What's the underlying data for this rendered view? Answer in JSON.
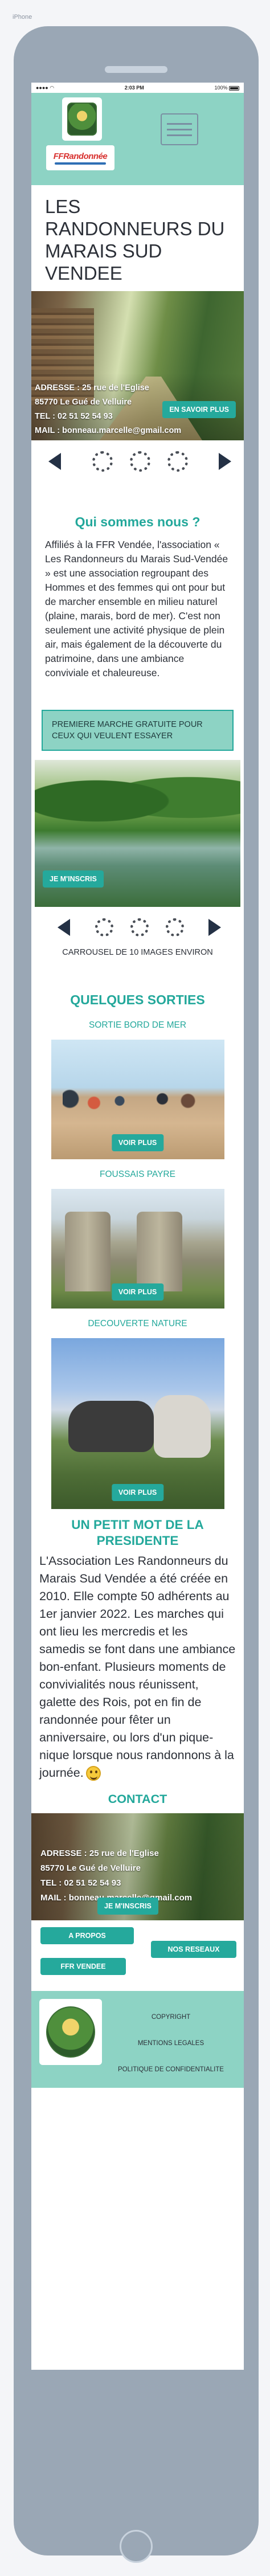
{
  "frame_label": "iPhone",
  "status_bar": {
    "time": "2:03 PM",
    "battery": "100%"
  },
  "header": {
    "ffr_logo_text": "FFRandonnée"
  },
  "site_title": "LES RANDONNEURS DU MARAIS SUD VENDEE",
  "hero": {
    "address": "ADRESSE : 25 rue de l'Eglise",
    "city": "85770 Le Gué de Velluire",
    "tel": "TEL : 02 51 52 54 93",
    "mail": "MAIL : bonneau.marcelle@gmail.com",
    "cta": "EN SAVOIR PLUS"
  },
  "about": {
    "title": "Qui sommes nous ?",
    "text": "Affiliés à la FFR Vendée, l'association « Les Randonneurs du Marais Sud-Vendée » est une association regroupant des Hommes et des femmes qui ont pour but de marcher ensemble en milieu naturel (plaine, marais, bord de mer). C'est non seulement une activité physique de plein air, mais également de la découverte du patrimoine, dans une ambiance conviviale et chaleureuse."
  },
  "promo": "PREMIERE MARCHE GRATUITE POUR CEUX QUI VEULENT ESSAYER",
  "inscription_label": "JE M'INSCRIS",
  "carousel_caption": "CARROUSEL DE 10 IMAGES ENVIRON",
  "sorties": {
    "title": "QUELQUES SORTIES",
    "items": [
      {
        "label": "SORTIE BORD DE MER",
        "cta": "VOIR PLUS"
      },
      {
        "label": "FOUSSAIS PAYRE",
        "cta": "VOIR PLUS"
      },
      {
        "label": "DECOUVERTE NATURE",
        "cta": "VOIR PLUS"
      }
    ]
  },
  "petit_mot": {
    "title": "UN PETIT MOT DE LA PRESIDENTE",
    "text": "L'Association Les Randonneurs du Marais Sud Vendée a été créée en 2010. Elle compte 50 adhérents au 1er janvier 2022. Les marches qui ont lieu les mercredis et les samedis se font dans une ambiance bon-enfant. Plusieurs moments de convivialités nous réunissent, galette des Rois, pot en fin de randonnée pour fêter un anniversaire, ou lors d'un pique-nique lorsque nous randonnons à la journée."
  },
  "contact": {
    "title": "CONTACT",
    "address": "ADRESSE : 25 rue de l'Eglise",
    "city": "85770 Le Gué de Velluire",
    "tel": "TEL : 02 51 52 54 93",
    "mail": "MAIL : bonneau.marcelle@gmail.com",
    "cta": "JE M'INSCRIS"
  },
  "footer": {
    "a_propos": "A PROPOS",
    "nos_reseaux": "NOS RESEAUX",
    "ffr_vendee": "FFR VENDEE",
    "copyright": "COPYRIGHT",
    "mentions": "MENTIONS LEGALES",
    "politique": "POLITIQUE DE CONFIDENTIALITE"
  },
  "colors": {
    "accent": "#25a99c",
    "header_bg": "#8dd3c4",
    "title_teal": "#23a89b",
    "frame": "#9aa7b5"
  }
}
